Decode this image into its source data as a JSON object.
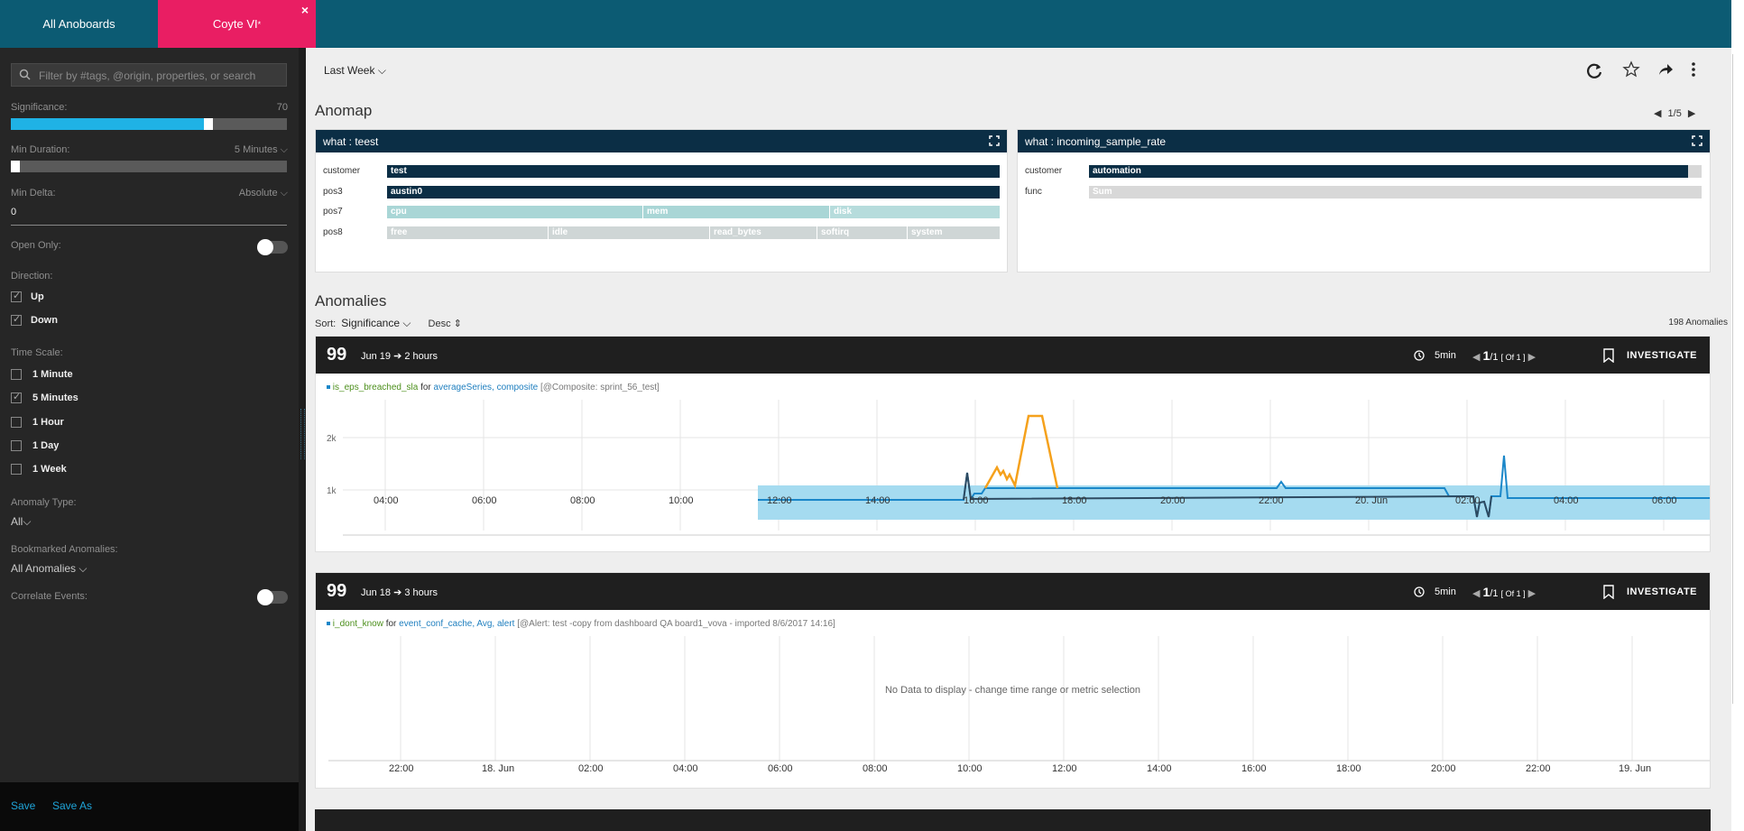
{
  "tabs": {
    "all": "All Anoboards",
    "active": "Coyte VI",
    "active_mark": "*",
    "close": "×"
  },
  "sidebar": {
    "search_placeholder": "Filter by #tags, @origin, properties, or search",
    "significance_label": "Significance:",
    "significance_value": "70",
    "significance_level": 0.7,
    "min_duration_label": "Min Duration:",
    "min_duration_value": "5 Minutes",
    "min_delta_label": "Min Delta:",
    "min_delta_mode": "Absolute",
    "min_delta_value": "0",
    "open_only_label": "Open Only:",
    "direction_label": "Direction:",
    "direction_options": [
      {
        "label": "Up",
        "checked": true
      },
      {
        "label": "Down",
        "checked": true
      }
    ],
    "time_scale_label": "Time Scale:",
    "time_scale_options": [
      {
        "label": "1 Minute",
        "checked": false
      },
      {
        "label": "5 Minutes",
        "checked": true
      },
      {
        "label": "1 Hour",
        "checked": false
      },
      {
        "label": "1 Day",
        "checked": false
      },
      {
        "label": "1 Week",
        "checked": false
      }
    ],
    "anomaly_type_label": "Anomaly Type:",
    "anomaly_type_value": "All",
    "bookmarked_label": "Bookmarked Anomalies:",
    "bookmarked_value": "All Anomalies",
    "correlate_label": "Correlate Events:",
    "save": "Save",
    "save_as": "Save As"
  },
  "toolbar": {
    "time_range": "Last Week"
  },
  "anomap": {
    "title": "Anomap",
    "page": "1/5",
    "panels": [
      {
        "title": "what : teest",
        "rows": [
          {
            "label": "customer",
            "segments": [
              "test"
            ]
          },
          {
            "label": "pos3",
            "segments": [
              "austin0"
            ]
          },
          {
            "label": "pos7",
            "segments": [
              "cpu",
              "mem",
              "disk"
            ]
          },
          {
            "label": "pos8",
            "segments": [
              "free",
              "idle",
              "read_bytes",
              "softirq",
              "system"
            ]
          }
        ]
      },
      {
        "title": "what : incoming_sample_rate",
        "rows": [
          {
            "label": "customer",
            "segments": [
              "automation"
            ]
          },
          {
            "label": "func",
            "segments": [
              "Sum"
            ]
          }
        ]
      }
    ]
  },
  "anomalies": {
    "title": "Anomalies",
    "sort_label": "Sort:",
    "sort_value": "Significance",
    "order": "Desc",
    "count": "198 Anomalies",
    "cards": [
      {
        "score": "99",
        "when": "Jun 19 ➔ 2 hours",
        "interval": "5min",
        "page_num": "1",
        "page_total": "/1",
        "page_of": "[ Of 1 ]",
        "investigate": "INVESTIGATE",
        "metric_name": "is_eps_breached_sla",
        "metric_for": "for",
        "metric_series": "averageSeries,",
        "metric_agg": "composite",
        "metric_note": "[@Composite: sprint_56_test]",
        "chart": {
          "y_ticks": [
            "2k",
            "1k"
          ],
          "x_ticks": [
            "04:00",
            "06:00",
            "08:00",
            "10:00",
            "12:00",
            "14:00",
            "16:00",
            "18:00",
            "20:00",
            "22:00",
            "20. Jun",
            "02:00",
            "04:00",
            "06:00"
          ]
        }
      },
      {
        "score": "99",
        "when": "Jun 18 ➔ 3 hours",
        "interval": "5min",
        "page_num": "1",
        "page_total": "/1",
        "page_of": "[ Of 1 ]",
        "investigate": "INVESTIGATE",
        "metric_name": "i_dont_know",
        "metric_for": "for",
        "metric_series": "event_conf_cache,",
        "metric_agg": "Avg,",
        "metric_alert": "alert",
        "metric_note": "[@Alert: test -copy from dashboard QA board1_vova - imported 8/6/2017 14:16]",
        "chart": {
          "empty_message": "No Data to display - change time range or metric selection",
          "x_ticks": [
            "22:00",
            "18. Jun",
            "02:00",
            "04:00",
            "06:00",
            "08:00",
            "10:00",
            "12:00",
            "14:00",
            "16:00",
            "18:00",
            "20:00",
            "22:00",
            "19. Jun"
          ]
        }
      }
    ]
  },
  "colors": {
    "topbar": "#0c5b73",
    "active_tab": "#e91e63",
    "accent": "#1fb2e5",
    "anomaly": "#f5a11c",
    "line": "#1a87c9",
    "band": "#a5dbf0"
  },
  "icons": [
    "search-icon",
    "chevron-down-icon",
    "refresh-icon",
    "star-icon",
    "share-icon",
    "more-icon",
    "expand-icon",
    "history-icon",
    "bookmark-icon",
    "caret-left-icon",
    "caret-right-icon"
  ]
}
